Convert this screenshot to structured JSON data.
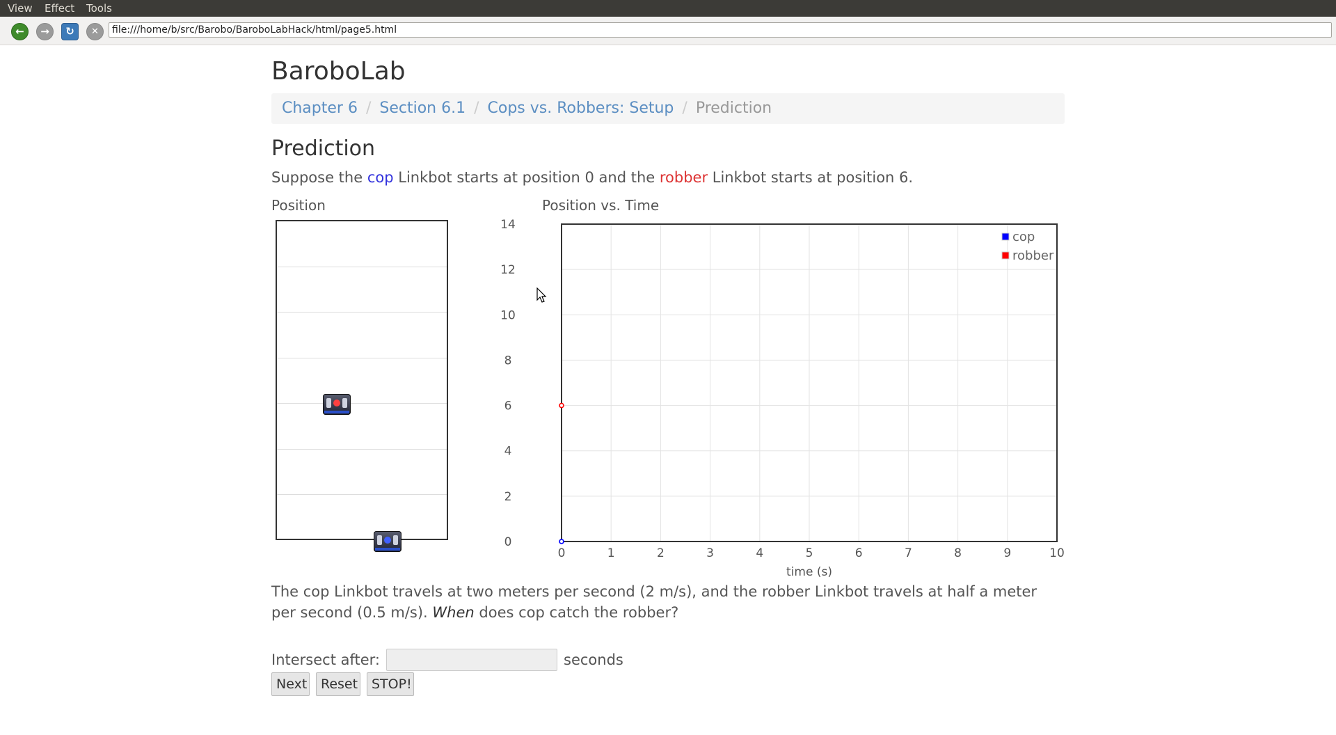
{
  "menubar": {
    "items": [
      {
        "label": "View"
      },
      {
        "label": "Effect"
      },
      {
        "label": "Tools"
      }
    ]
  },
  "navbar": {
    "url": "file:///home/b/src/Barobo/BaroboLabHack/html/page5.html",
    "icons": {
      "back": "back-arrow-icon",
      "forward": "forward-arrow-icon",
      "reload": "reload-icon",
      "stop": "stop-icon"
    }
  },
  "page": {
    "title": "BaroboLab",
    "breadcrumb": [
      "Chapter 6",
      "Section 6.1",
      "Cops vs. Robbers: Setup",
      "Prediction"
    ],
    "heading": "Prediction",
    "intro": {
      "pre": "Suppose the ",
      "cop_word": "cop",
      "mid": " Linkbot starts at position 0 and the ",
      "robber_word": "robber",
      "post": " Linkbot starts at position 6."
    },
    "position_label": "Position",
    "pvt_label": "Position vs. Time",
    "description": {
      "part1": "The cop Linkbot travels at two meters per second (2 m/s), and the robber Linkbot travels at half a meter per second (0.5 m/s). ",
      "emphasis": "When",
      "part2": " does cop catch the robber?"
    },
    "intersect_label": "Intersect after:",
    "intersect_value": "",
    "seconds_label": "seconds",
    "buttons": {
      "next": "Next",
      "reset": "Reset",
      "stop": "STOP!"
    }
  },
  "position_track": {
    "cop_position": 0,
    "robber_position": 6,
    "range": [
      0,
      14
    ],
    "robot_icon": "linkbot-robot-icon"
  },
  "chart_data": {
    "type": "scatter",
    "title": "Position vs. Time",
    "xlabel": "time (s)",
    "ylabel": "",
    "xlim": [
      0,
      10
    ],
    "ylim": [
      0,
      14
    ],
    "x_ticks": [
      "0",
      "1",
      "2",
      "3",
      "4",
      "5",
      "6",
      "7",
      "8",
      "9",
      "10"
    ],
    "y_ticks": [
      "0",
      "2",
      "4",
      "6",
      "8",
      "10",
      "12",
      "14"
    ],
    "grid": true,
    "legend_position": "top-right",
    "series": [
      {
        "name": "cop",
        "color": "#0000ff",
        "points": [
          [
            0,
            0
          ]
        ]
      },
      {
        "name": "robber",
        "color": "#ff0000",
        "points": [
          [
            0,
            6
          ]
        ]
      }
    ]
  }
}
